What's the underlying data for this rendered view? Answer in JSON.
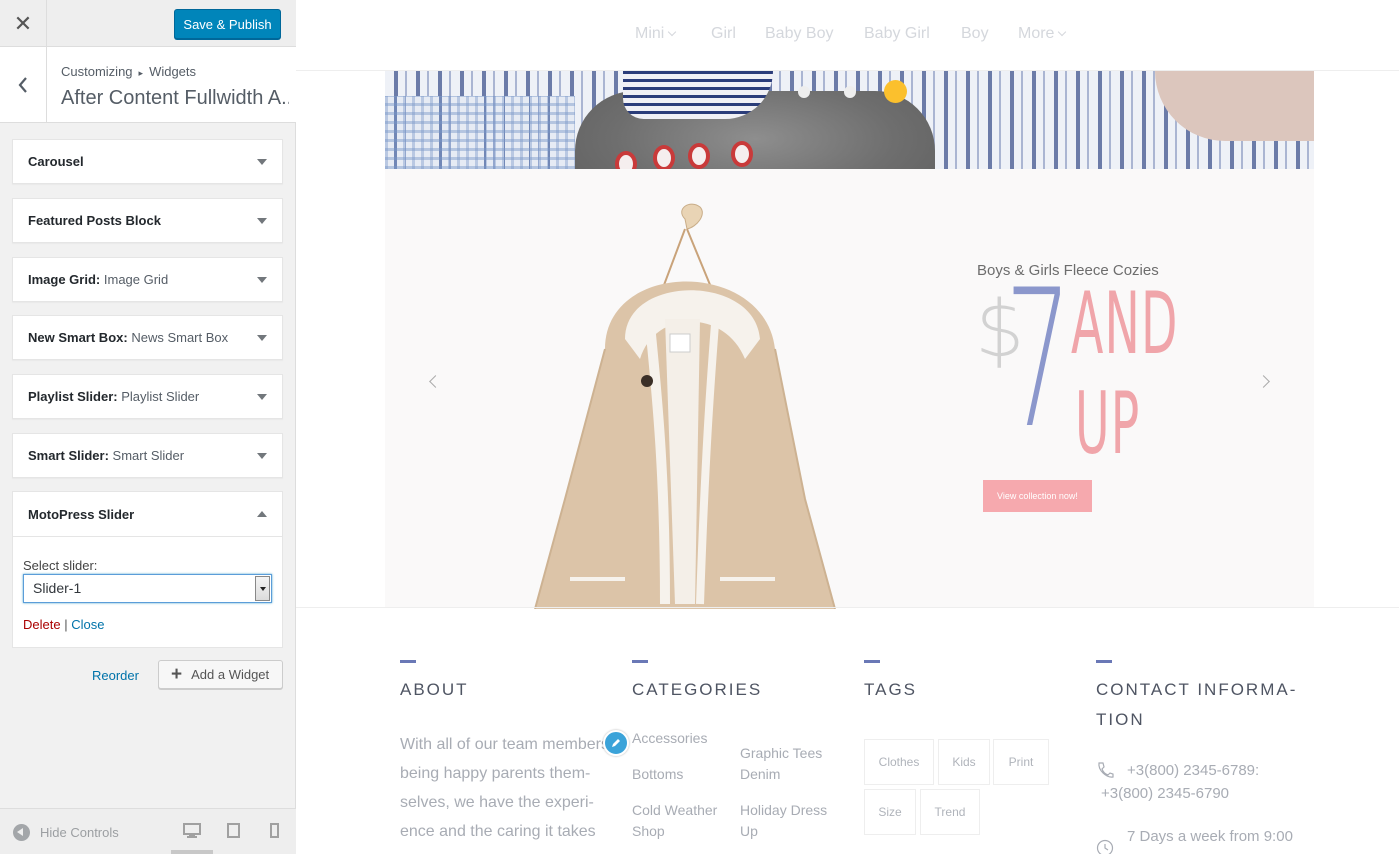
{
  "header": {
    "close_label": "✕",
    "save_label": "Save & Publish"
  },
  "section": {
    "breadcrumb": [
      "Customizing",
      "Widgets"
    ],
    "title": "After Content Fullwidth A..."
  },
  "widgets": [
    {
      "name": "Carousel",
      "instance": ""
    },
    {
      "name": "Featured Posts Block",
      "instance": ""
    },
    {
      "name": "Image Grid:",
      "instance": "Image Grid"
    },
    {
      "name": "New Smart Box:",
      "instance": "News Smart Box"
    },
    {
      "name": "Playlist Slider:",
      "instance": "Playlist Slider"
    },
    {
      "name": "Smart Slider:",
      "instance": "Smart Slider"
    }
  ],
  "open_widget": {
    "name": "MotoPress Slider",
    "select_label": "Select slider:",
    "selected_value": "Slider-1",
    "delete_label": "Delete",
    "separator": "|",
    "close_label": "Close"
  },
  "actions": {
    "reorder_label": "Reorder",
    "add_widget_label": "Add a Widget"
  },
  "footer_controls": {
    "hide_label": "Hide Controls",
    "devices": [
      "desktop-icon",
      "tablet-icon",
      "mobile-icon"
    ]
  },
  "preview": {
    "nav": [
      "Mini",
      "Girl",
      "Baby Boy",
      "Baby Girl",
      "Boy",
      "More"
    ],
    "promo": {
      "subtitle": "Boys & Girls Fleece Cozies",
      "dollar": "$",
      "price": "7",
      "and": "AND",
      "up": "UP",
      "button": "View collection now!"
    },
    "colors": {
      "accent": "#6a78b6",
      "pink": "#f6a9ae",
      "active_dot": "#fbc02d",
      "primary_button": "#0085ba"
    },
    "footer": {
      "about": {
        "title": "ABOUT",
        "text": "With all of our team members being happy parents them-selves, we have the experi-ence and the caring it takes"
      },
      "categories": {
        "title": "CATEGORIES",
        "items": [
          "Accessories",
          "Graphic Tees",
          "Denim",
          "Bottoms",
          "Cold Weather",
          "Shop",
          "Holiday Dress",
          "Up"
        ]
      },
      "tags": {
        "title": "TAGS",
        "items": [
          "Clothes",
          "Kids",
          "Print",
          "Size",
          "Trend"
        ]
      },
      "contact": {
        "title_line1": "CONTACT INFORMA-",
        "title_line2": "TION",
        "phone_line1": "+3(800) 2345-6789:",
        "phone_line2": "+3(800) 2345-6790",
        "hours": "7 Days a week from 9:00"
      }
    }
  }
}
